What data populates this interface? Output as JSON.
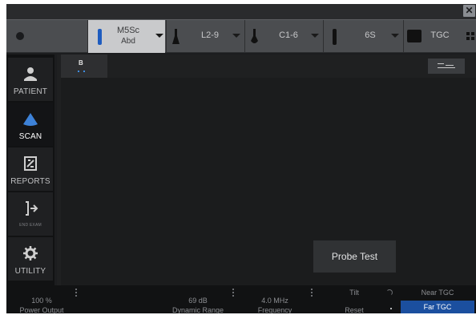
{
  "window": {
    "close_glyph": "✕"
  },
  "probes": [
    {
      "name": "M5Sc",
      "preset": "Abd",
      "active": true,
      "icon": "probe-transducer-icon",
      "color": "#1e5cbf"
    },
    {
      "name": "L2-9",
      "preset": "",
      "active": false,
      "icon": "probe-transducer-icon"
    },
    {
      "name": "C1-6",
      "preset": "",
      "active": false,
      "icon": "probe-transducer-icon"
    },
    {
      "name": "6S",
      "preset": "",
      "active": false,
      "icon": "probe-transducer-icon"
    }
  ],
  "tgc_button": {
    "label": "TGC",
    "icon": "tgc-icon",
    "right_icon": "grid-icon"
  },
  "sidebar": {
    "items": [
      {
        "label": "PATIENT",
        "icon": "patient-icon"
      },
      {
        "label": "SCAN",
        "icon": "scan-icon",
        "active": true,
        "color": "#3d82d8"
      },
      {
        "label": "REPORTS",
        "icon": "reports-icon"
      },
      {
        "label": "END EXAM",
        "icon": "end-exam-icon"
      },
      {
        "label": "UTILITY",
        "icon": "gear-icon"
      }
    ]
  },
  "image_area": {
    "mode_tab": "B",
    "probe_test_label": "Probe Test",
    "layout_icon": "layout-icon"
  },
  "bottom": {
    "power": {
      "value": "100 %",
      "label": "Power Output"
    },
    "dynamic_range": {
      "value": "69 dB",
      "label": "Dynamic Range"
    },
    "frequency": {
      "value": "4.0 MHz",
      "label": "Frequency"
    },
    "tilt": {
      "top": "Tilt",
      "label": "Reset"
    },
    "near_tgc": "Near TGC",
    "far_tgc": "Far TGC"
  },
  "colors": {
    "accent": "#1b4f9f",
    "frame": "#1c1d1f"
  }
}
